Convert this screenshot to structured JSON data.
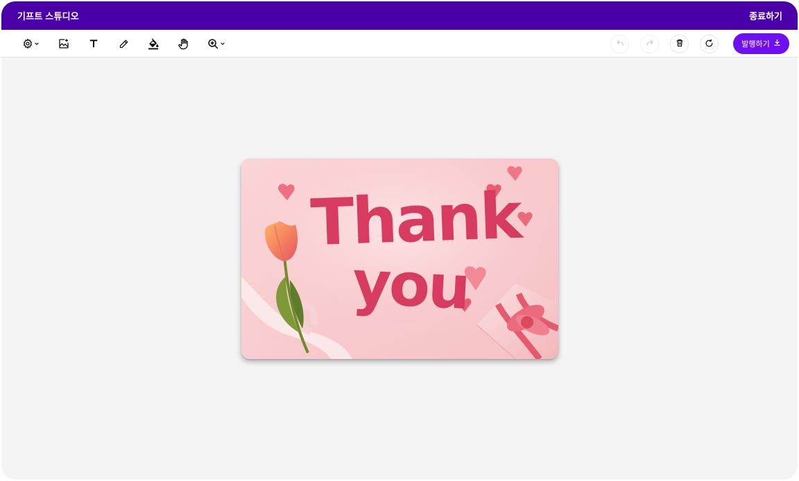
{
  "titlebar": {
    "title": "기프트 스튜디오",
    "exit_label": "종료하기",
    "background": "#4a00a8"
  },
  "toolbar": {
    "tools": [
      {
        "name": "settings",
        "icon": "gear-icon",
        "has_dropdown": true
      },
      {
        "name": "image",
        "icon": "image-add-icon"
      },
      {
        "name": "text",
        "icon": "text-icon"
      },
      {
        "name": "pen",
        "icon": "pencil-icon"
      },
      {
        "name": "fill",
        "icon": "paint-bucket-icon"
      },
      {
        "name": "pan",
        "icon": "hand-icon"
      },
      {
        "name": "zoom",
        "icon": "zoom-in-icon",
        "has_dropdown": true
      }
    ],
    "undo_icon": "undo-icon",
    "redo_icon": "redo-icon",
    "delete_icon": "trash-icon",
    "reset_icon": "refresh-icon",
    "publish_label": "발행하기",
    "publish_icon": "download-icon",
    "accent": "#6e0ff0"
  },
  "card": {
    "line1": "Thank",
    "line2": "you",
    "text_color": "#d73c60",
    "background": "#f9cfd2"
  }
}
